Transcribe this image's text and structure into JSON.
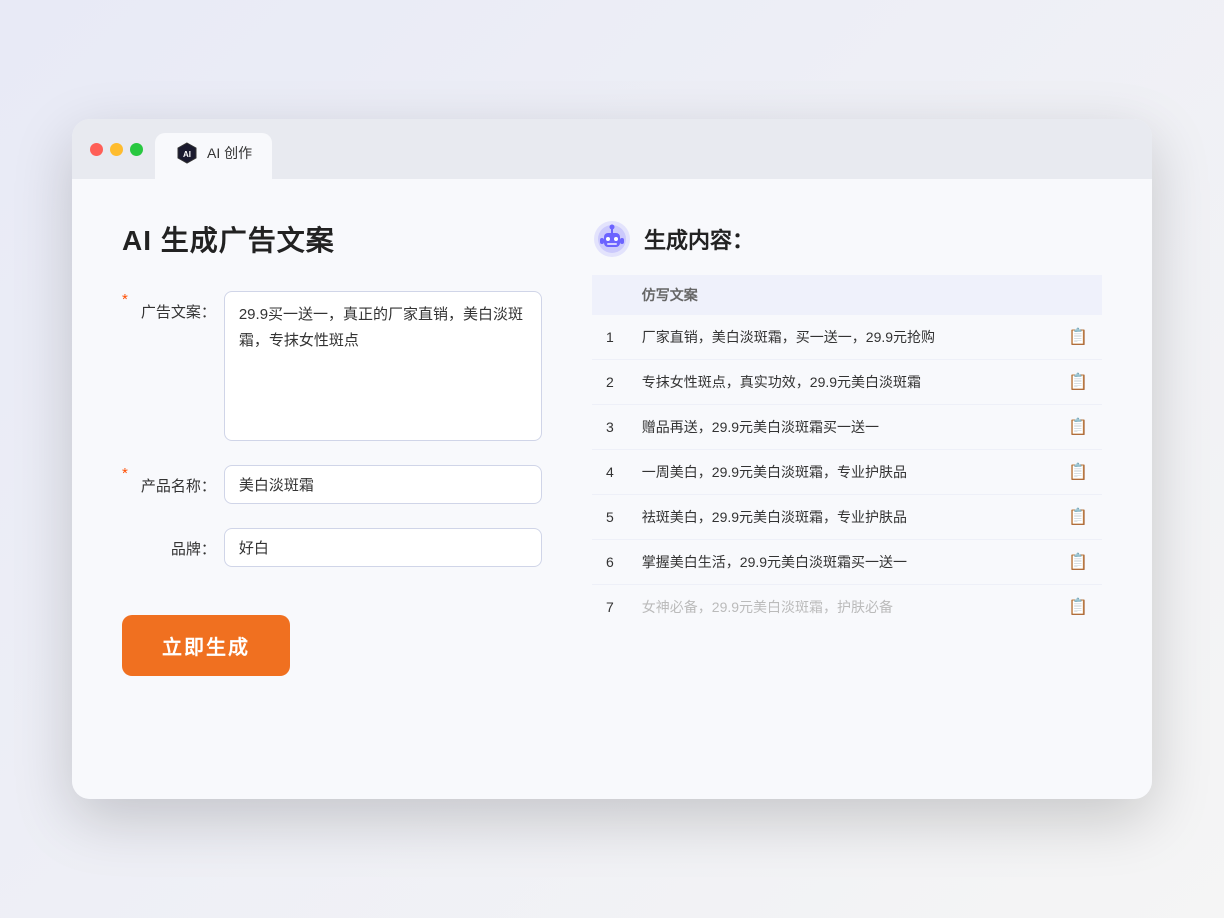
{
  "window": {
    "tab_label": "AI 创作"
  },
  "left": {
    "title": "AI 生成广告文案",
    "fields": [
      {
        "id": "ad_copy",
        "label": "广告文案：",
        "required": true,
        "type": "textarea",
        "value": "29.9买一送一，真正的厂家直销，美白淡斑霜，专抹女性斑点"
      },
      {
        "id": "product_name",
        "label": "产品名称：",
        "required": true,
        "type": "input",
        "value": "美白淡斑霜"
      },
      {
        "id": "brand",
        "label": "品牌：",
        "required": false,
        "type": "input",
        "value": "好白"
      }
    ],
    "generate_button": "立即生成"
  },
  "right": {
    "title": "生成内容：",
    "column_header": "仿写文案",
    "results": [
      {
        "num": "1",
        "text": "厂家直销，美白淡斑霜，买一送一，29.9元抢购",
        "muted": false
      },
      {
        "num": "2",
        "text": "专抹女性斑点，真实功效，29.9元美白淡斑霜",
        "muted": false
      },
      {
        "num": "3",
        "text": "赠品再送，29.9元美白淡斑霜买一送一",
        "muted": false
      },
      {
        "num": "4",
        "text": "一周美白，29.9元美白淡斑霜，专业护肤品",
        "muted": false
      },
      {
        "num": "5",
        "text": "祛斑美白，29.9元美白淡斑霜，专业护肤品",
        "muted": false
      },
      {
        "num": "6",
        "text": "掌握美白生活，29.9元美白淡斑霜买一送一",
        "muted": false
      },
      {
        "num": "7",
        "text": "女神必备，29.9元美白淡斑霜，护肤必备",
        "muted": true
      }
    ]
  }
}
